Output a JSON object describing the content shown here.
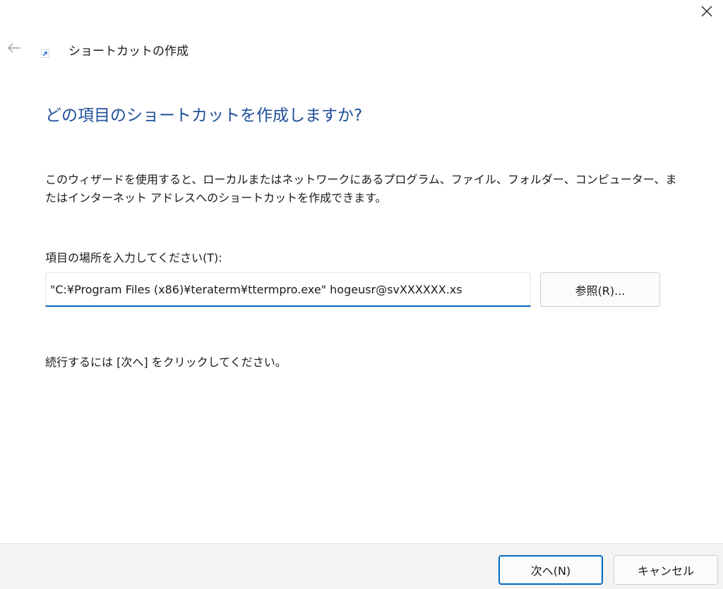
{
  "window": {
    "title": "ショートカットの作成",
    "close_icon": "close-icon",
    "back_icon": "back-arrow-icon",
    "shortcut_icon": "shortcut-arrow-icon"
  },
  "main": {
    "heading": "どの項目のショートカットを作成しますか?",
    "description": "このウィザードを使用すると、ローカルまたはネットワークにあるプログラム、ファイル、フォルダー、コンピューター、またはインターネット アドレスへのショートカットを作成できます。",
    "location_label": "項目の場所を入力してください(T):",
    "location_value": "\"C:¥Program Files (x86)¥teraterm¥ttermpro.exe\" hogeusr@svXXXXXX.xs",
    "browse_label": "参照(R)...",
    "continue_text": "続行するには [次へ] をクリックしてください。"
  },
  "footer": {
    "next_label": "次へ(N)",
    "cancel_label": "キャンセル"
  },
  "colors": {
    "heading": "#1f4f9a",
    "accent": "#0067c0",
    "footer_bg": "#f3f3f3"
  }
}
